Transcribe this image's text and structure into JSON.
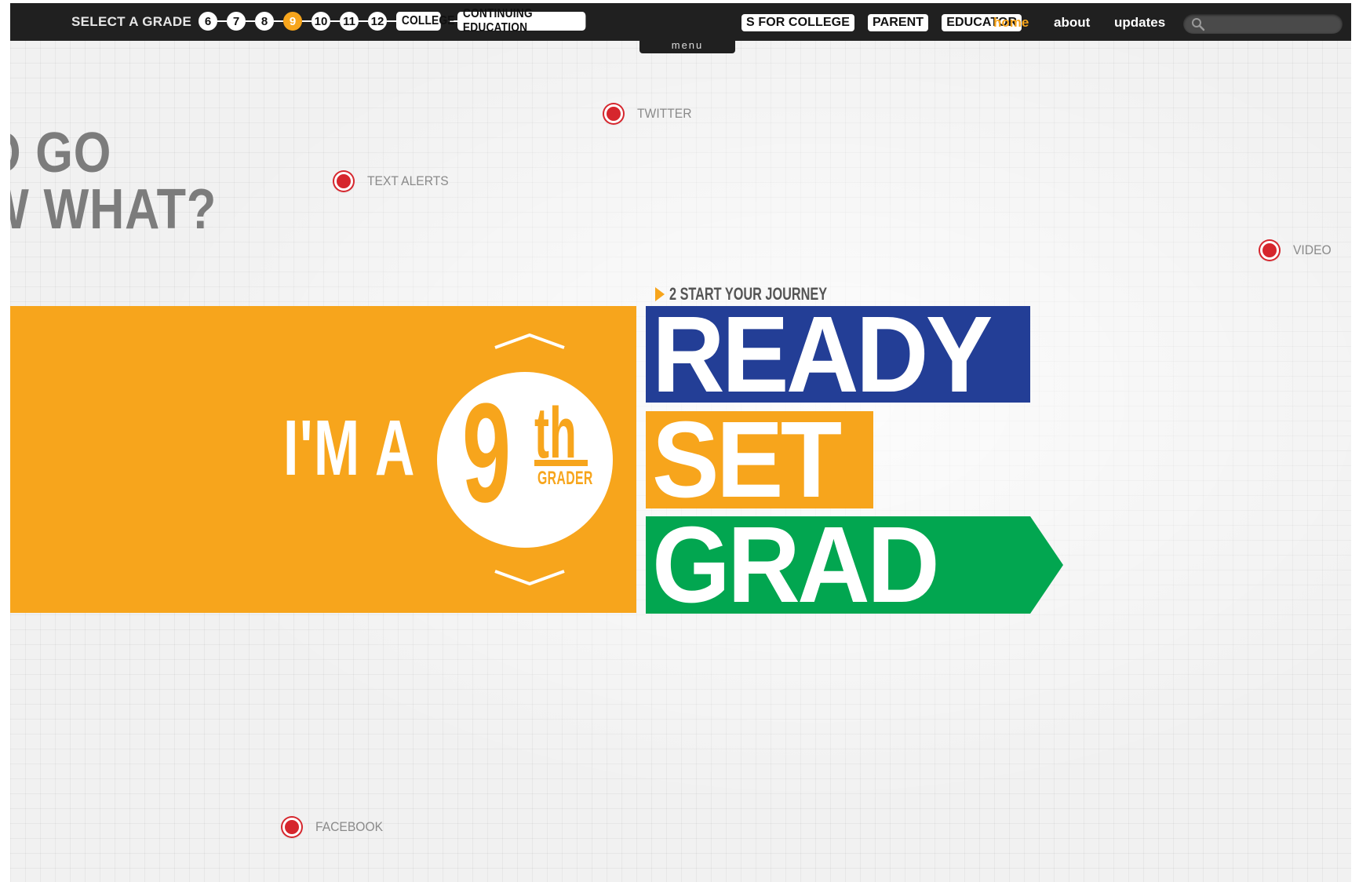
{
  "nav": {
    "select_label": "SELECT A GRADE",
    "grades": [
      {
        "label": "6",
        "active": false
      },
      {
        "label": "7",
        "active": false
      },
      {
        "label": "8",
        "active": false
      },
      {
        "label": "9",
        "active": true
      },
      {
        "label": "10",
        "active": false
      },
      {
        "label": "11",
        "active": false
      },
      {
        "label": "12",
        "active": false
      }
    ],
    "college": "COLLEGE",
    "continuing": "CONTINUING EDUCATION",
    "audience": [
      "S FOR COLLEGE",
      "PARENT",
      "EDUCATOR"
    ],
    "links": {
      "home": "home",
      "about": "about",
      "updates": "updates"
    },
    "menu": "menu",
    "search_value": ""
  },
  "headline": {
    "line1": "O GO",
    "line2": "W WHAT?"
  },
  "social": {
    "twitter": "TWITTER",
    "text_alerts": "TEXT ALERTS",
    "video": "VIDEO",
    "facebook": "FACEBOOK"
  },
  "journey": {
    "label": "2 START YOUR JOURNEY"
  },
  "panel": {
    "im_a": "I'M A",
    "number": "9",
    "suffix": "th",
    "grader": "GRADER"
  },
  "brand": {
    "ready": "READY",
    "set": "SET",
    "grad": "GRAD"
  },
  "colors": {
    "orange": "#f7a51c",
    "blue": "#233e96",
    "green": "#02a650",
    "red": "#d6262d",
    "topbar": "#202020"
  }
}
